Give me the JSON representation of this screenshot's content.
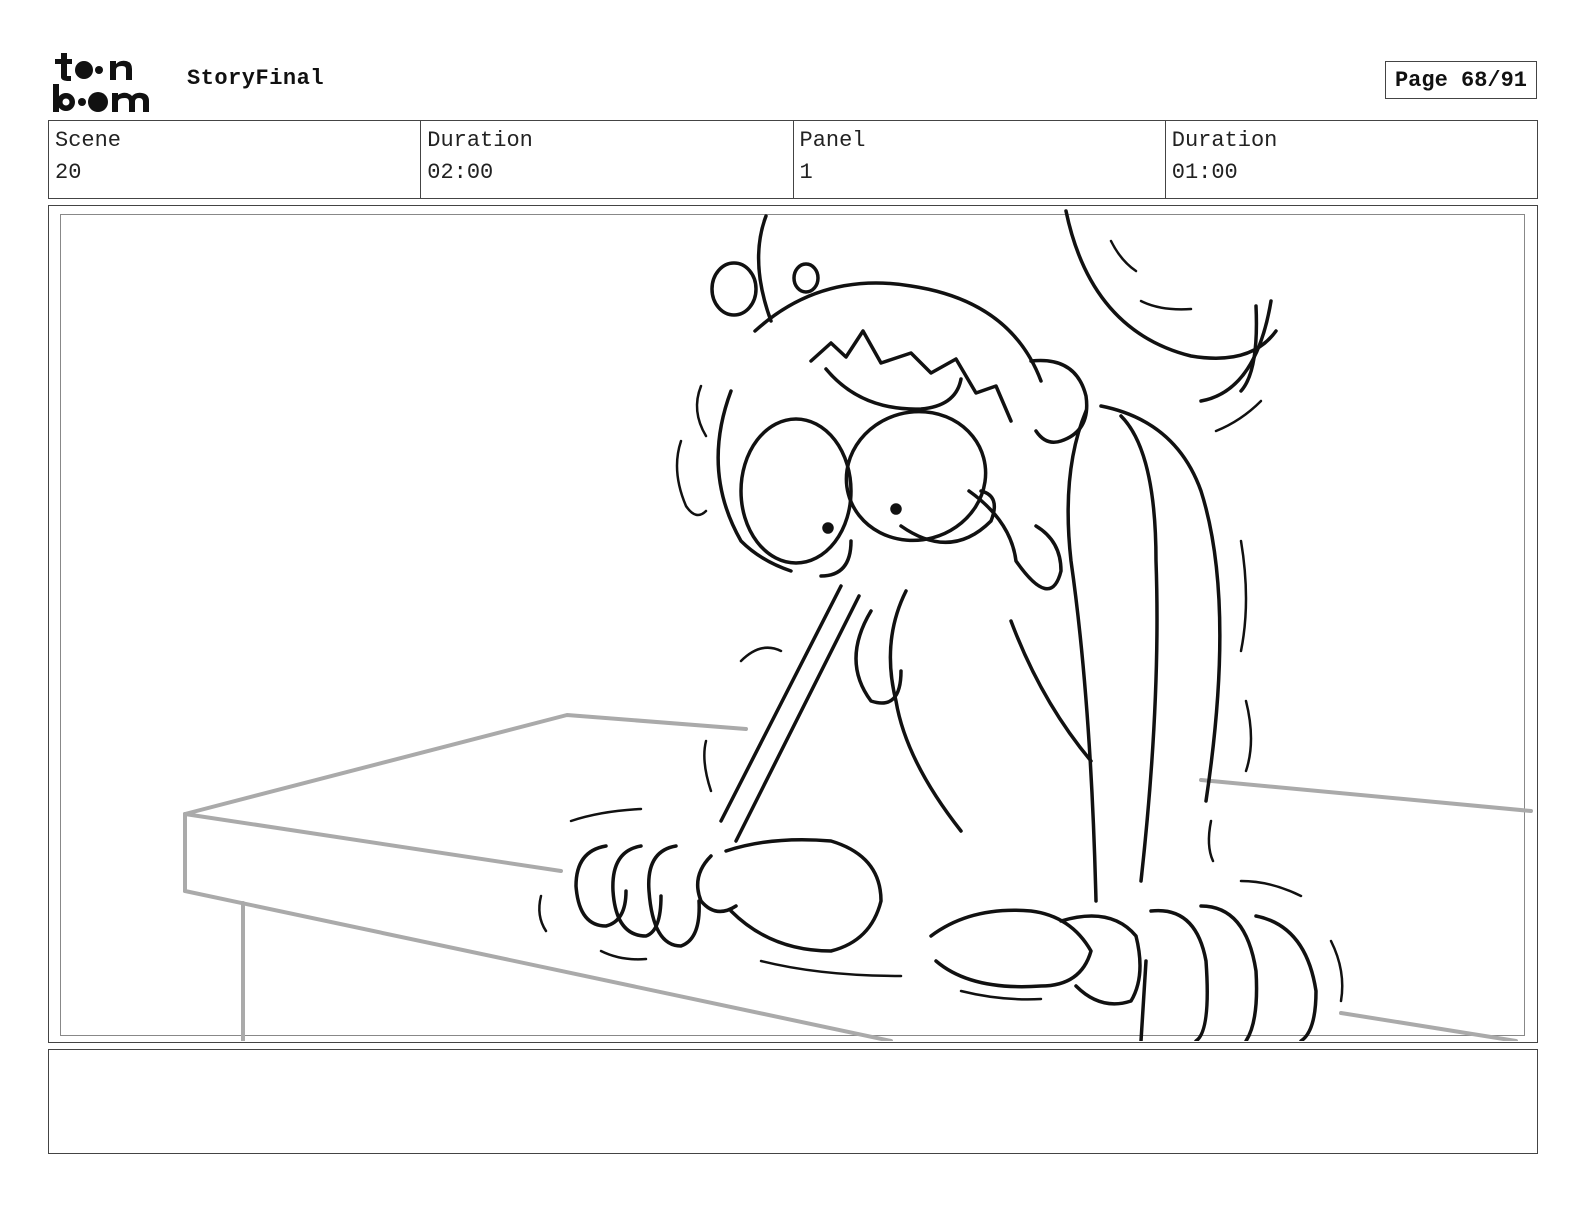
{
  "header": {
    "logo_text_top": "toon",
    "logo_text_bottom": "boom",
    "project_title": "StoryFinal",
    "page_indicator": "Page 68/91"
  },
  "info": {
    "scene_label": "Scene",
    "scene_value": "20",
    "scene_duration_label": "Duration",
    "scene_duration_value": "02:00",
    "panel_label": "Panel",
    "panel_value": "1",
    "panel_duration_label": "Duration",
    "panel_duration_value": "01:00"
  },
  "notes": {
    "text": ""
  }
}
